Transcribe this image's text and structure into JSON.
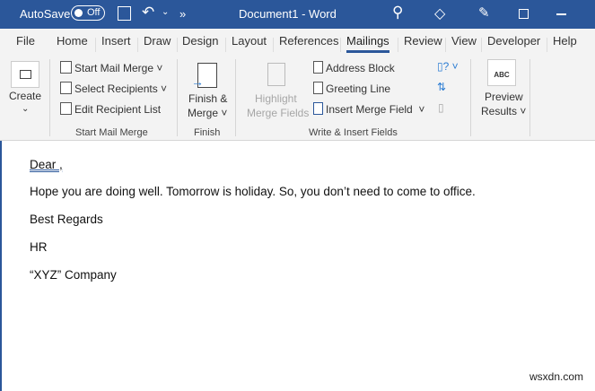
{
  "titlebar": {
    "autosave_label": "AutoSave",
    "autosave_state": "Off",
    "more": "»",
    "title": "Document1 - Word"
  },
  "tabs": [
    "File",
    "Home",
    "Insert",
    "Draw",
    "Design",
    "Layout",
    "References",
    "Mailings",
    "Review",
    "View",
    "Developer",
    "Help"
  ],
  "active_tab": "Mailings",
  "ribbon": {
    "create": {
      "label": "Create",
      "chevron": "⌄"
    },
    "start_mail_merge": "Start Mail Merge",
    "select_recipients": "Select Recipients",
    "edit_recipient_list": "Edit Recipient List",
    "finish_line1": "Finish &",
    "finish_line2": "Merge",
    "highlight_line1": "Highlight",
    "highlight_line2": "Merge Fields",
    "address_block": "Address Block",
    "greeting_line": "Greeting Line",
    "insert_merge_field": "Insert Merge Field",
    "preview_line1": "Preview",
    "preview_line2": "Results",
    "preview_icon_text": "ABC",
    "groups": {
      "start": "Start Mail Merge",
      "finish": "Finish",
      "write": "Write & Insert Fields"
    }
  },
  "document": {
    "lines": [
      "Dear ,",
      "Hope you are doing well. Tomorrow is holiday. So, you don’t need to come to office.",
      "Best Regards",
      "HR",
      "“XYZ” Company"
    ]
  },
  "watermark": "wsxdn.com"
}
